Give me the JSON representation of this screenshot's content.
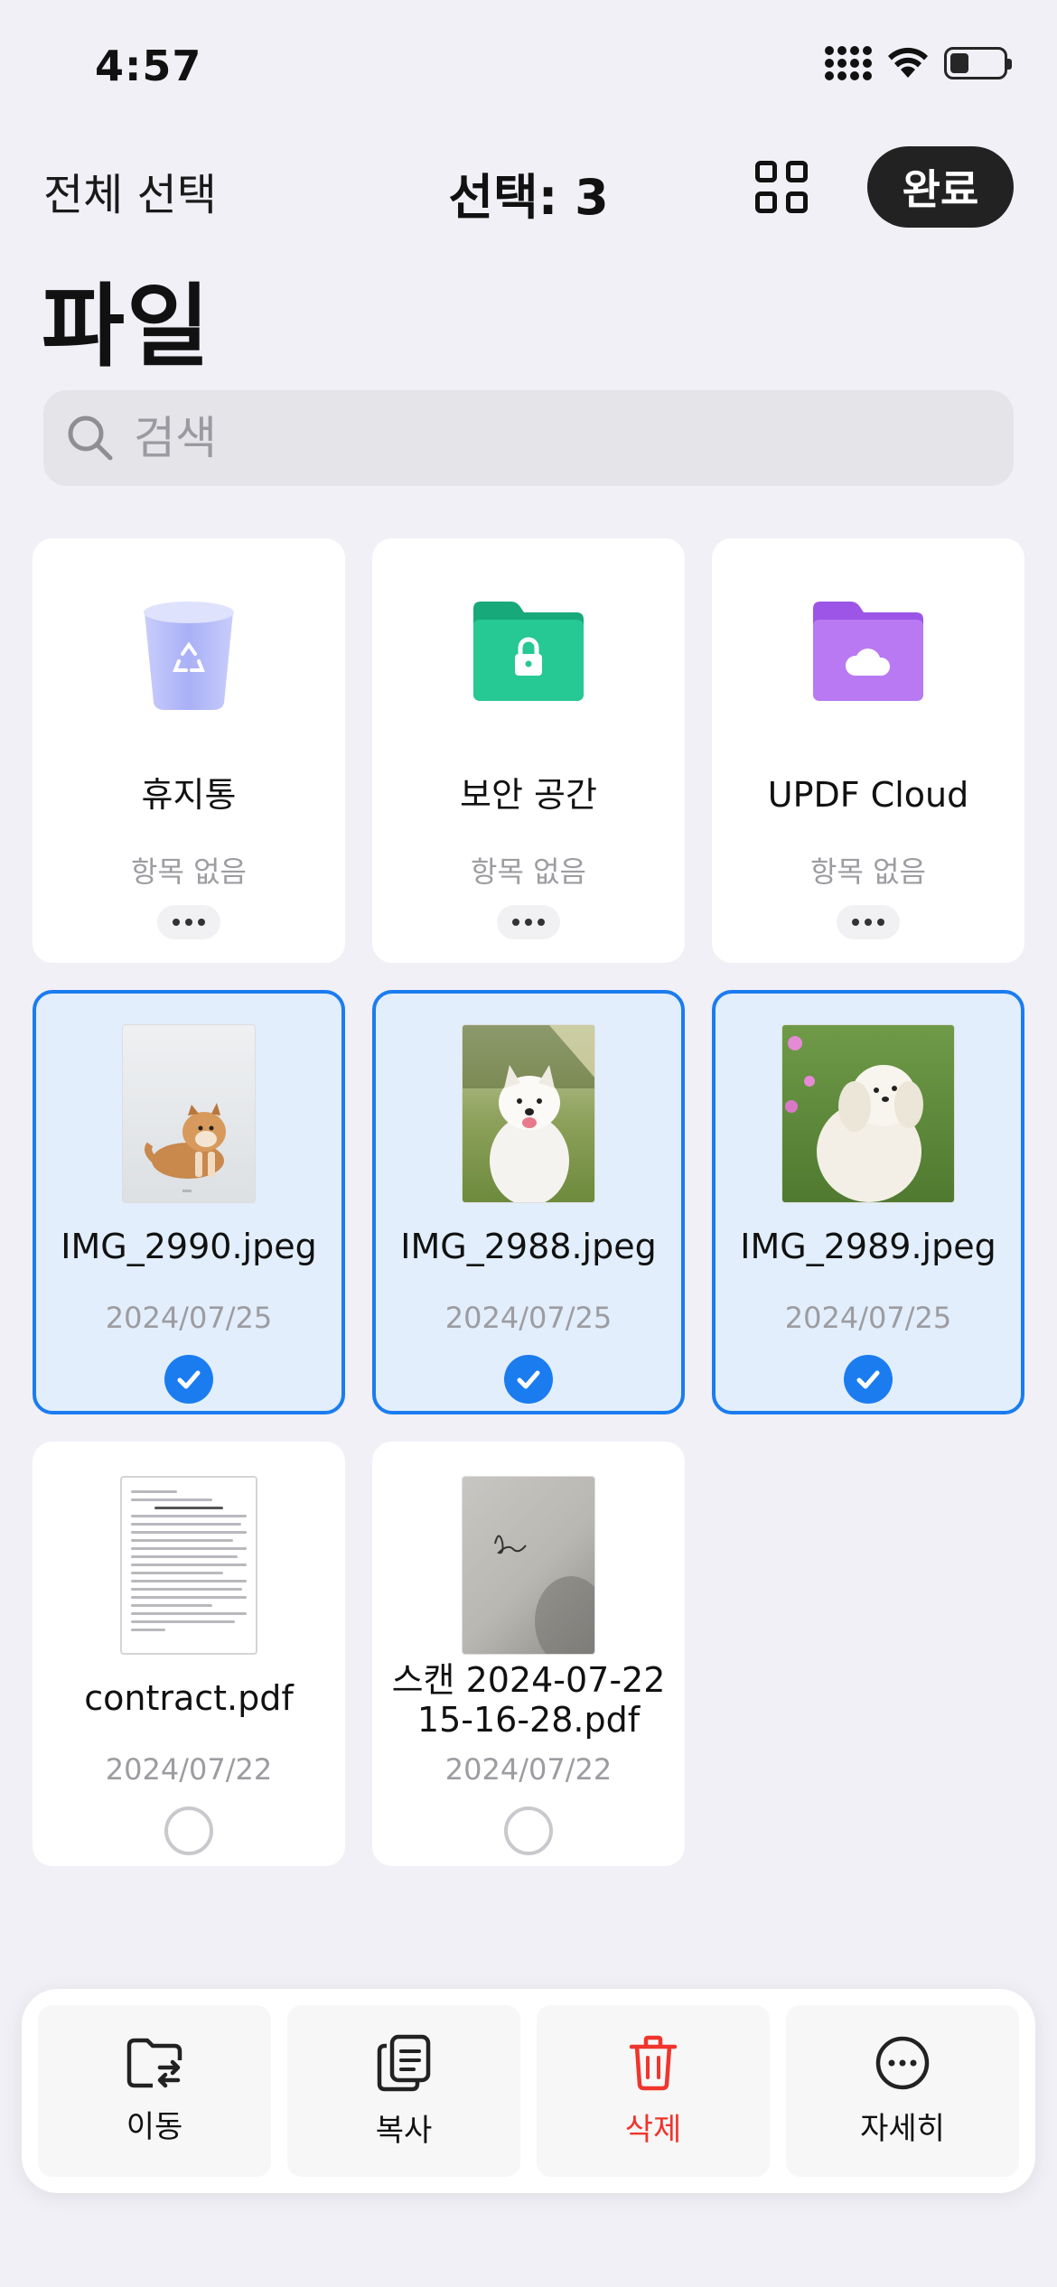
{
  "status_bar": {
    "time": "4:57",
    "battery_level": 0.35
  },
  "nav": {
    "select_all": "전체 선택",
    "selection_count": "선택: 3",
    "done_label": "완료"
  },
  "page_title": "파일",
  "search": {
    "placeholder": "검색"
  },
  "folders": [
    {
      "name": "휴지통",
      "subtitle": "항목 없음",
      "icon": "trash-bin-icon"
    },
    {
      "name": "보안 공간",
      "subtitle": "항목 없음",
      "icon": "secure-folder-icon"
    },
    {
      "name": "UPDF Cloud",
      "subtitle": "항목 없음",
      "icon": "cloud-folder-icon"
    }
  ],
  "files": [
    {
      "name": "IMG_2990.jpeg",
      "date": "2024/07/25",
      "selected": true,
      "thumb": "shiba-puppy-photo"
    },
    {
      "name": "IMG_2988.jpeg",
      "date": "2024/07/25",
      "selected": true,
      "thumb": "samoyed-photo"
    },
    {
      "name": "IMG_2989.jpeg",
      "date": "2024/07/25",
      "selected": true,
      "thumb": "white-poodle-photo"
    },
    {
      "name": "contract.pdf",
      "date": "2024/07/22",
      "selected": false,
      "thumb": "contract-document"
    },
    {
      "name_line1": "스캔 2024-07-22",
      "name_line2": "15-16-28.pdf",
      "date": "2024/07/22",
      "selected": false,
      "thumb": "scan-signature-document"
    }
  ],
  "toolbar": {
    "move": "이동",
    "copy": "복사",
    "delete": "삭제",
    "more": "자세히"
  },
  "colors": {
    "accent": "#1b7cf0",
    "danger": "#f0352c",
    "selected_bg": "#e2eefb",
    "secure_folder": "#1fbf8b",
    "cloud_folder": "#b46cf0"
  }
}
